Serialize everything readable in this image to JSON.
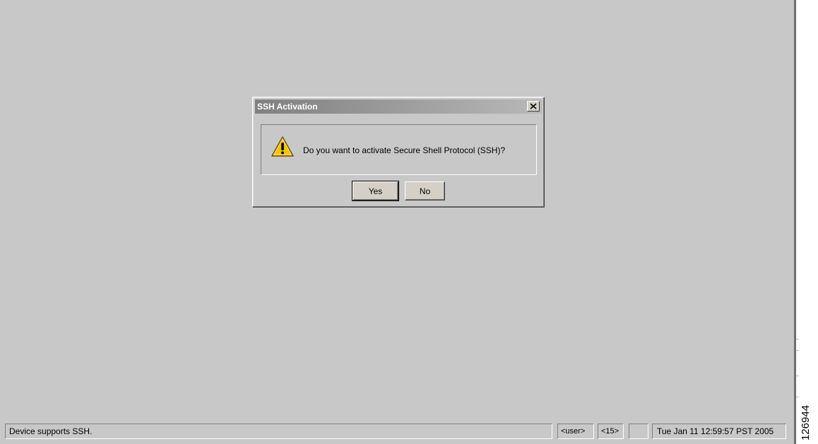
{
  "dialog": {
    "title": "SSH Activation",
    "close_label": "×",
    "message": "Do you want to activate Secure Shell Protocol (SSH)?",
    "yes_label": "Yes",
    "no_label": "No",
    "icon": "warning-icon"
  },
  "statusbar": {
    "message": "Device supports SSH.",
    "user": "<user>",
    "privilege": "<15>",
    "blank": "",
    "datetime": "Tue Jan 11 12:59:57 PST 2005"
  },
  "figure_id": "126944",
  "colors": {
    "desktop": "#c8c8c8",
    "titlebar_start": "#808080",
    "titlebar_end": "#b8b8b8",
    "warning_fill": "#f5c400"
  }
}
